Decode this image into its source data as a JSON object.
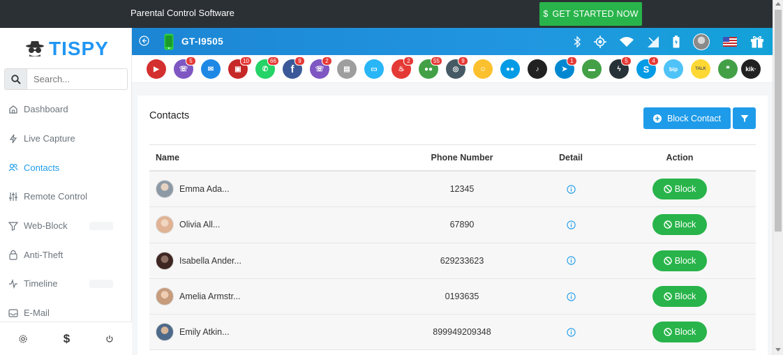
{
  "promo": {
    "text": "Parental Control Software",
    "cta_label": "GET STARTED NOW",
    "cta_icon": "dollar-icon"
  },
  "brand": {
    "name": "TISPY",
    "color": "#2196f3"
  },
  "search": {
    "placeholder": "Search..."
  },
  "sidebar": {
    "items": [
      {
        "label": "Dashboard",
        "icon": "home-icon",
        "active": false
      },
      {
        "label": "Live Capture",
        "icon": "lightning-icon",
        "active": false
      },
      {
        "label": "Contacts",
        "icon": "users-icon",
        "active": true
      },
      {
        "label": "Remote Control",
        "icon": "sliders-icon",
        "active": false
      },
      {
        "label": "Web-Block",
        "icon": "filter-icon",
        "active": false
      },
      {
        "label": "Anti-Theft",
        "icon": "lock-icon",
        "active": false
      },
      {
        "label": "Timeline",
        "icon": "activity-icon",
        "active": false
      },
      {
        "label": "E-Mail",
        "icon": "inbox-icon",
        "active": false
      }
    ],
    "footer": [
      "gear-icon",
      "dollar-icon",
      "power-icon"
    ]
  },
  "device": {
    "name": "GT-I9505",
    "status_icons": [
      "bluetooth-icon",
      "gps-icon",
      "wifi-icon",
      "signal-icon",
      "battery-icon",
      "user-avatar",
      "flag-us-icon",
      "gift-icon"
    ]
  },
  "apps": [
    {
      "name": "video-call",
      "color": "#d32f2f",
      "badge": ""
    },
    {
      "name": "phone-calls",
      "color": "#7e57c2",
      "badge": "5"
    },
    {
      "name": "email",
      "color": "#1e88e5",
      "badge": ""
    },
    {
      "name": "photos",
      "color": "#c62828",
      "badge": "10"
    },
    {
      "name": "whatsapp",
      "color": "#25d366",
      "badge": "66"
    },
    {
      "name": "facebook",
      "color": "#3b5998",
      "badge": "9"
    },
    {
      "name": "viber",
      "color": "#7e57c2",
      "badge": "2"
    },
    {
      "name": "clipboard",
      "color": "#9e9e9e",
      "badge": ""
    },
    {
      "name": "screen",
      "color": "#29b6f6",
      "badge": ""
    },
    {
      "name": "tinder",
      "color": "#e53935",
      "badge": "2"
    },
    {
      "name": "wechat",
      "color": "#43a047",
      "badge": "55"
    },
    {
      "name": "instagram",
      "color": "#455a64",
      "badge": "9"
    },
    {
      "name": "snapchat",
      "color": "#fbc02d",
      "badge": ""
    },
    {
      "name": "flickr",
      "color": "#039be5",
      "badge": ""
    },
    {
      "name": "tiktok",
      "color": "#212121",
      "badge": ""
    },
    {
      "name": "telegram",
      "color": "#0288d1",
      "badge": "1"
    },
    {
      "name": "line",
      "color": "#43a047",
      "badge": ""
    },
    {
      "name": "messenger",
      "color": "#263238",
      "badge": "5"
    },
    {
      "name": "skype",
      "color": "#039be5",
      "badge": "4"
    },
    {
      "name": "bip",
      "color": "#4fc3f7",
      "badge": ""
    },
    {
      "name": "talk",
      "color": "#fdd835",
      "badge": ""
    },
    {
      "name": "hangouts",
      "color": "#43a047",
      "badge": ""
    },
    {
      "name": "kik",
      "color": "#212121",
      "badge": ""
    }
  ],
  "contacts": {
    "title": "Contacts",
    "block_contact_label": "Block Contact",
    "columns": {
      "name": "Name",
      "phone": "Phone Number",
      "detail": "Detail",
      "action": "Action"
    },
    "block_label": "Block",
    "rows": [
      {
        "name": "Emma Ada...",
        "phone": "12345",
        "avatar_color": "#8d9aa6"
      },
      {
        "name": "Olivia All...",
        "phone": "67890",
        "avatar_color": "#e0b394"
      },
      {
        "name": "Isabella Ander...",
        "phone": "629233623",
        "avatar_color": "#5d4037"
      },
      {
        "name": "Amelia Armstr...",
        "phone": "0193635",
        "avatar_color": "#c69c7d"
      },
      {
        "name": "Emily Atkin...",
        "phone": "899949209348",
        "avatar_color": "#4e6a8a"
      }
    ]
  }
}
